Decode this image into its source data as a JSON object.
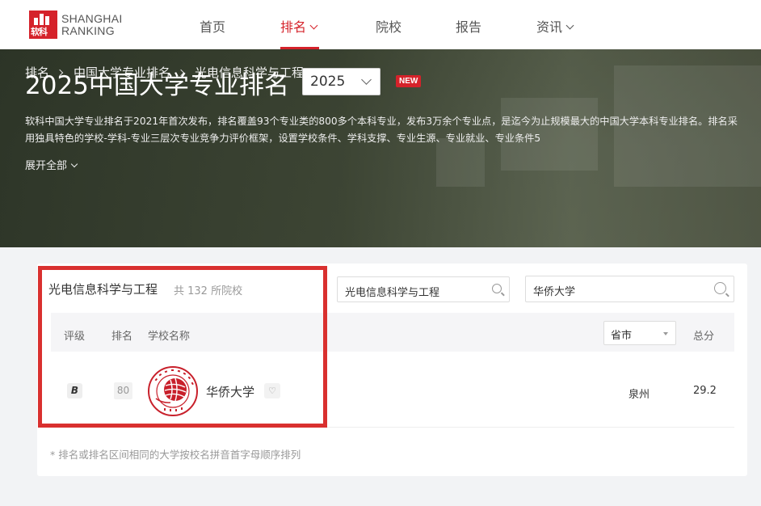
{
  "header": {
    "logo": {
      "line1": "SHANGHAI",
      "line2": "RANKING",
      "mark_text": "软科"
    },
    "nav": [
      {
        "label": "首页",
        "active": false,
        "has_dropdown": false
      },
      {
        "label": "排名",
        "active": true,
        "has_dropdown": true
      },
      {
        "label": "院校",
        "active": false,
        "has_dropdown": false
      },
      {
        "label": "报告",
        "active": false,
        "has_dropdown": false
      },
      {
        "label": "资讯",
        "active": false,
        "has_dropdown": true
      }
    ]
  },
  "breadcrumb": [
    "排名",
    "中国大学专业排名",
    "光电信息科学与工程"
  ],
  "hero": {
    "title": "2025中国大学专业排名",
    "year": "2025",
    "badge": "NEW",
    "description": "软科中国大学专业排名于2021年首次发布，排名覆盖93个专业类的800多个本科专业，发布3万余个专业点，是迄今为止规模最大的中国大学本科专业排名。排名采用独具特色的学校-学科-专业三层次专业竞争力评价框架，设置学校条件、学科支撑、专业生源、专业就业、专业条件5",
    "expand_label": "展开全部"
  },
  "ranking": {
    "subject": "光电信息科学与工程",
    "count_text": "共 132 所院校",
    "subject_search_value": "光电信息科学与工程",
    "school_search_value": "华侨大学",
    "columns": {
      "grade": "评级",
      "rank": "排名",
      "school": "学校名称",
      "province": "省市",
      "score": "总分"
    },
    "rows": [
      {
        "grade": "B",
        "rank": "80",
        "school": "华侨大学",
        "province": "泉州",
        "score": "29.2",
        "fav_icon": "♡"
      }
    ],
    "footnote": "* 排名或排名区间相同的大学按校名拼音首字母顺序排列"
  },
  "colors": {
    "accent": "#d5222a",
    "highlight": "#d9302f"
  }
}
